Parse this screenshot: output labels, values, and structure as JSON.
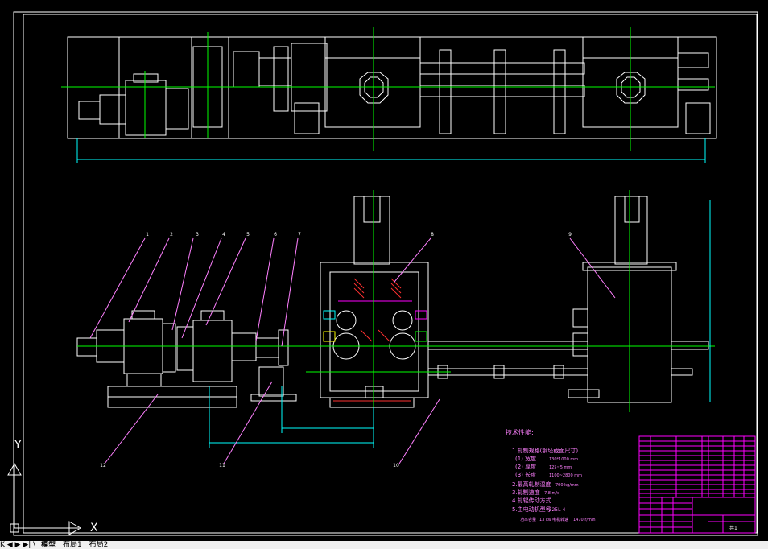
{
  "drawing": {
    "notes_title": "技术性能:",
    "notes": [
      "1.轧制规格(钢坯截面尺寸)",
      "(1) 宽度",
      "(2) 厚度",
      "(3) 长度",
      "2.最高轧制温度",
      "3.轧制速度",
      "4.轧辊传动方式",
      "5.主电动机型号"
    ],
    "note_values": [
      "130*1000 mm",
      "125~5 mm",
      "1100~2800 mm",
      "700 kg/mm",
      "7.8 m/s"
    ],
    "motor_model": "Y225L-4",
    "motor_extra": [
      "功率容量",
      "13 kw",
      "电机转速",
      "1470 r/min"
    ],
    "balloons": [
      "1",
      "2",
      "3",
      "4",
      "5",
      "6",
      "7",
      "8",
      "9",
      "10",
      "11",
      "12"
    ],
    "axis_x": "X",
    "axis_y": "Y",
    "title_block_mark": "共1"
  },
  "tabs": {
    "nav": "K ◀ ▶ ▶| \\",
    "items": [
      "模型",
      "布局1",
      "布局2"
    ]
  },
  "colors": {
    "background": "#000000",
    "lines": "#ffffff",
    "centerlines": "#00ff00",
    "dimensions": "#00ffff",
    "leaders": "#ff80ff",
    "hatch": "#ff3030",
    "title_block": "#ff00ff",
    "accent_yellow": "#ffff00"
  }
}
